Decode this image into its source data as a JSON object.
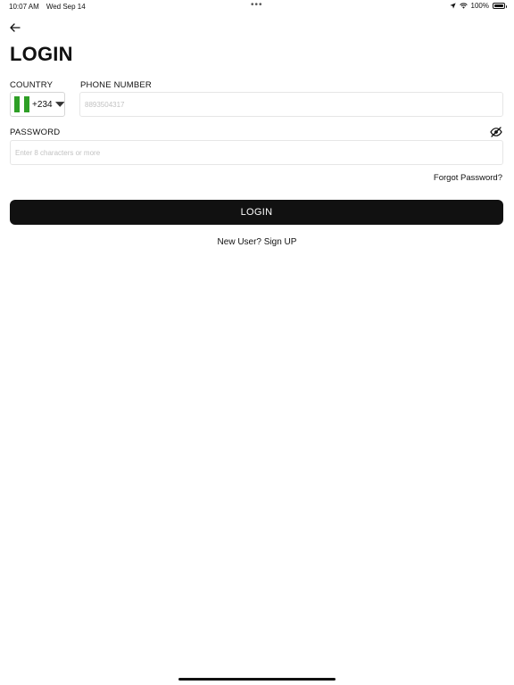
{
  "status_bar": {
    "time": "10:07 AM",
    "date": "Wed Sep 14",
    "multitask_dots": "•••",
    "battery_percent": "100%",
    "battery_level": 1.0,
    "icons": [
      "location-arrow-icon",
      "wifi-icon",
      "battery-icon"
    ]
  },
  "header": {
    "back_icon": "arrow-left-icon",
    "title": "LOGIN"
  },
  "form": {
    "country": {
      "label": "COUNTRY",
      "selected_code": "+234",
      "flag": "nigeria-flag-icon",
      "flag_colors": [
        "#2e9f26",
        "#ffffff",
        "#2e9f26"
      ]
    },
    "phone": {
      "label": "PHONE NUMBER",
      "value": "",
      "placeholder": "8893504317"
    },
    "password": {
      "label": "PASSWORD",
      "value": "",
      "placeholder": "Enter 8 characters or more",
      "toggle_icon": "eye-off-icon"
    },
    "forgot_password": "Forgot Password?",
    "submit_label": "LOGIN",
    "signup_text": "New User? Sign UP"
  },
  "colors": {
    "primary_button": "#111111",
    "button_text": "#ffffff",
    "input_border": "#e6e6e6",
    "placeholder": "#c2c2c2"
  }
}
